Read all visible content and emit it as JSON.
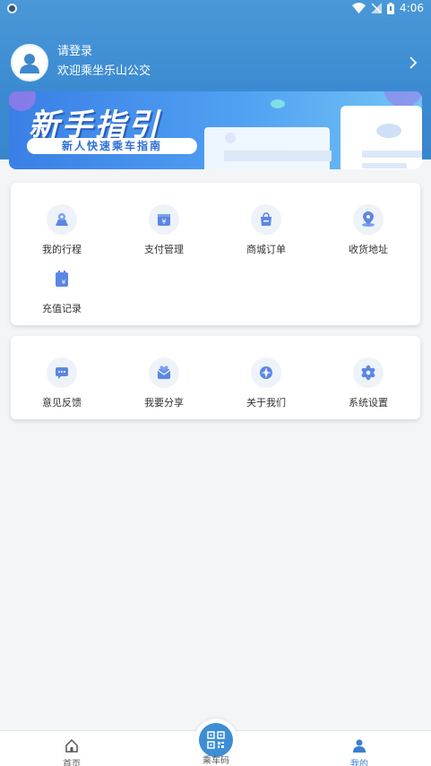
{
  "status_bar": {
    "time": "4:06"
  },
  "profile": {
    "login": "请登录",
    "welcome": "欢迎乘坐乐山公交"
  },
  "banner": {
    "title": "新手指引",
    "subtitle": "新人快速乘车指南"
  },
  "menu_primary": [
    {
      "label": "我的行程",
      "icon": "map-location-icon"
    },
    {
      "label": "支付管理",
      "icon": "payment-icon"
    },
    {
      "label": "商城订单",
      "icon": "shopping-bag-icon"
    },
    {
      "label": "收货地址",
      "icon": "address-pin-icon"
    },
    {
      "label": "充值记录",
      "icon": "recharge-record-icon"
    }
  ],
  "menu_secondary": [
    {
      "label": "意见反馈",
      "icon": "feedback-icon"
    },
    {
      "label": "我要分享",
      "icon": "share-icon"
    },
    {
      "label": "关于我们",
      "icon": "about-icon"
    },
    {
      "label": "系统设置",
      "icon": "settings-gear-icon"
    }
  ],
  "tabbar": {
    "home": "首页",
    "ride_code": "乘车码",
    "mine": "我的"
  },
  "colors": {
    "primary": "#3b8ad1",
    "icon_blue": "#5b86e5",
    "active_tab": "#3a7fd0"
  }
}
